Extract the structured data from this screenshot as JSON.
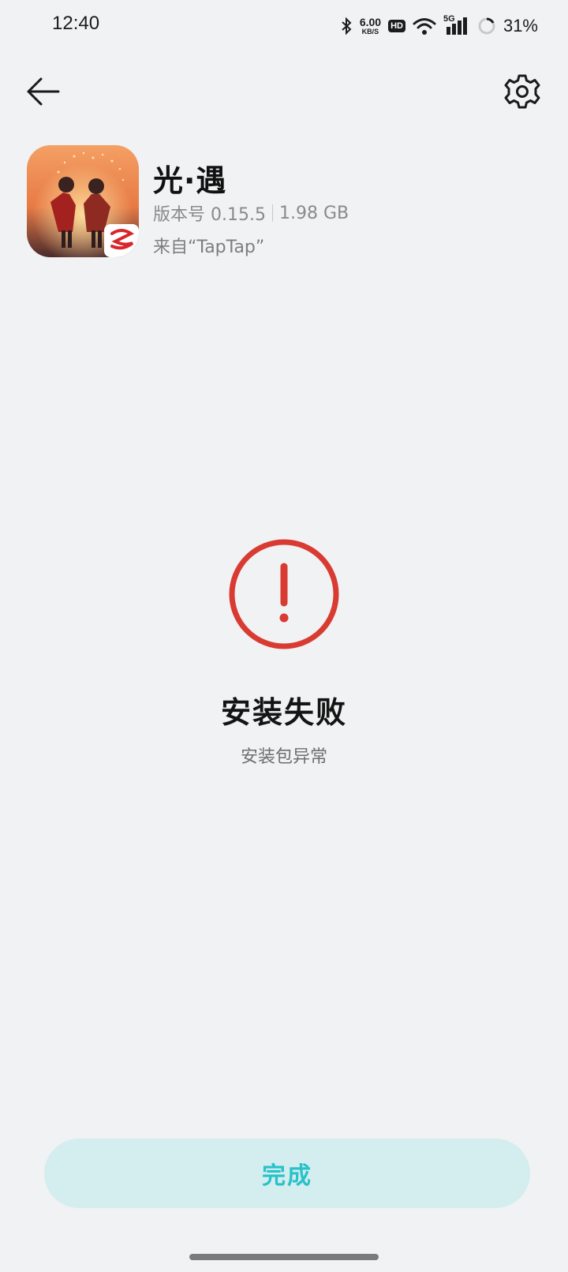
{
  "status_bar": {
    "time": "12:40",
    "net_speed_value": "6.00",
    "net_speed_unit": "KB/S",
    "hd_badge": "HD",
    "network_type": "5G",
    "battery_percent": "31%"
  },
  "app": {
    "name": "光·遇",
    "version": "版本号 0.15.5",
    "size": "1.98 GB",
    "source": "来自“TapTap”"
  },
  "result": {
    "title": "安装失败",
    "subtitle": "安装包异常"
  },
  "actions": {
    "done_label": "完成"
  },
  "colors": {
    "background": "#f1f2f4",
    "error_red": "#d93a31",
    "button_bg": "#d4edef",
    "button_text": "#29c2c9"
  },
  "icons": [
    "back-arrow-icon",
    "gear-icon",
    "error-exclamation-icon",
    "bluetooth-icon",
    "wifi-icon",
    "signal-icon",
    "battery-ring-icon"
  ]
}
